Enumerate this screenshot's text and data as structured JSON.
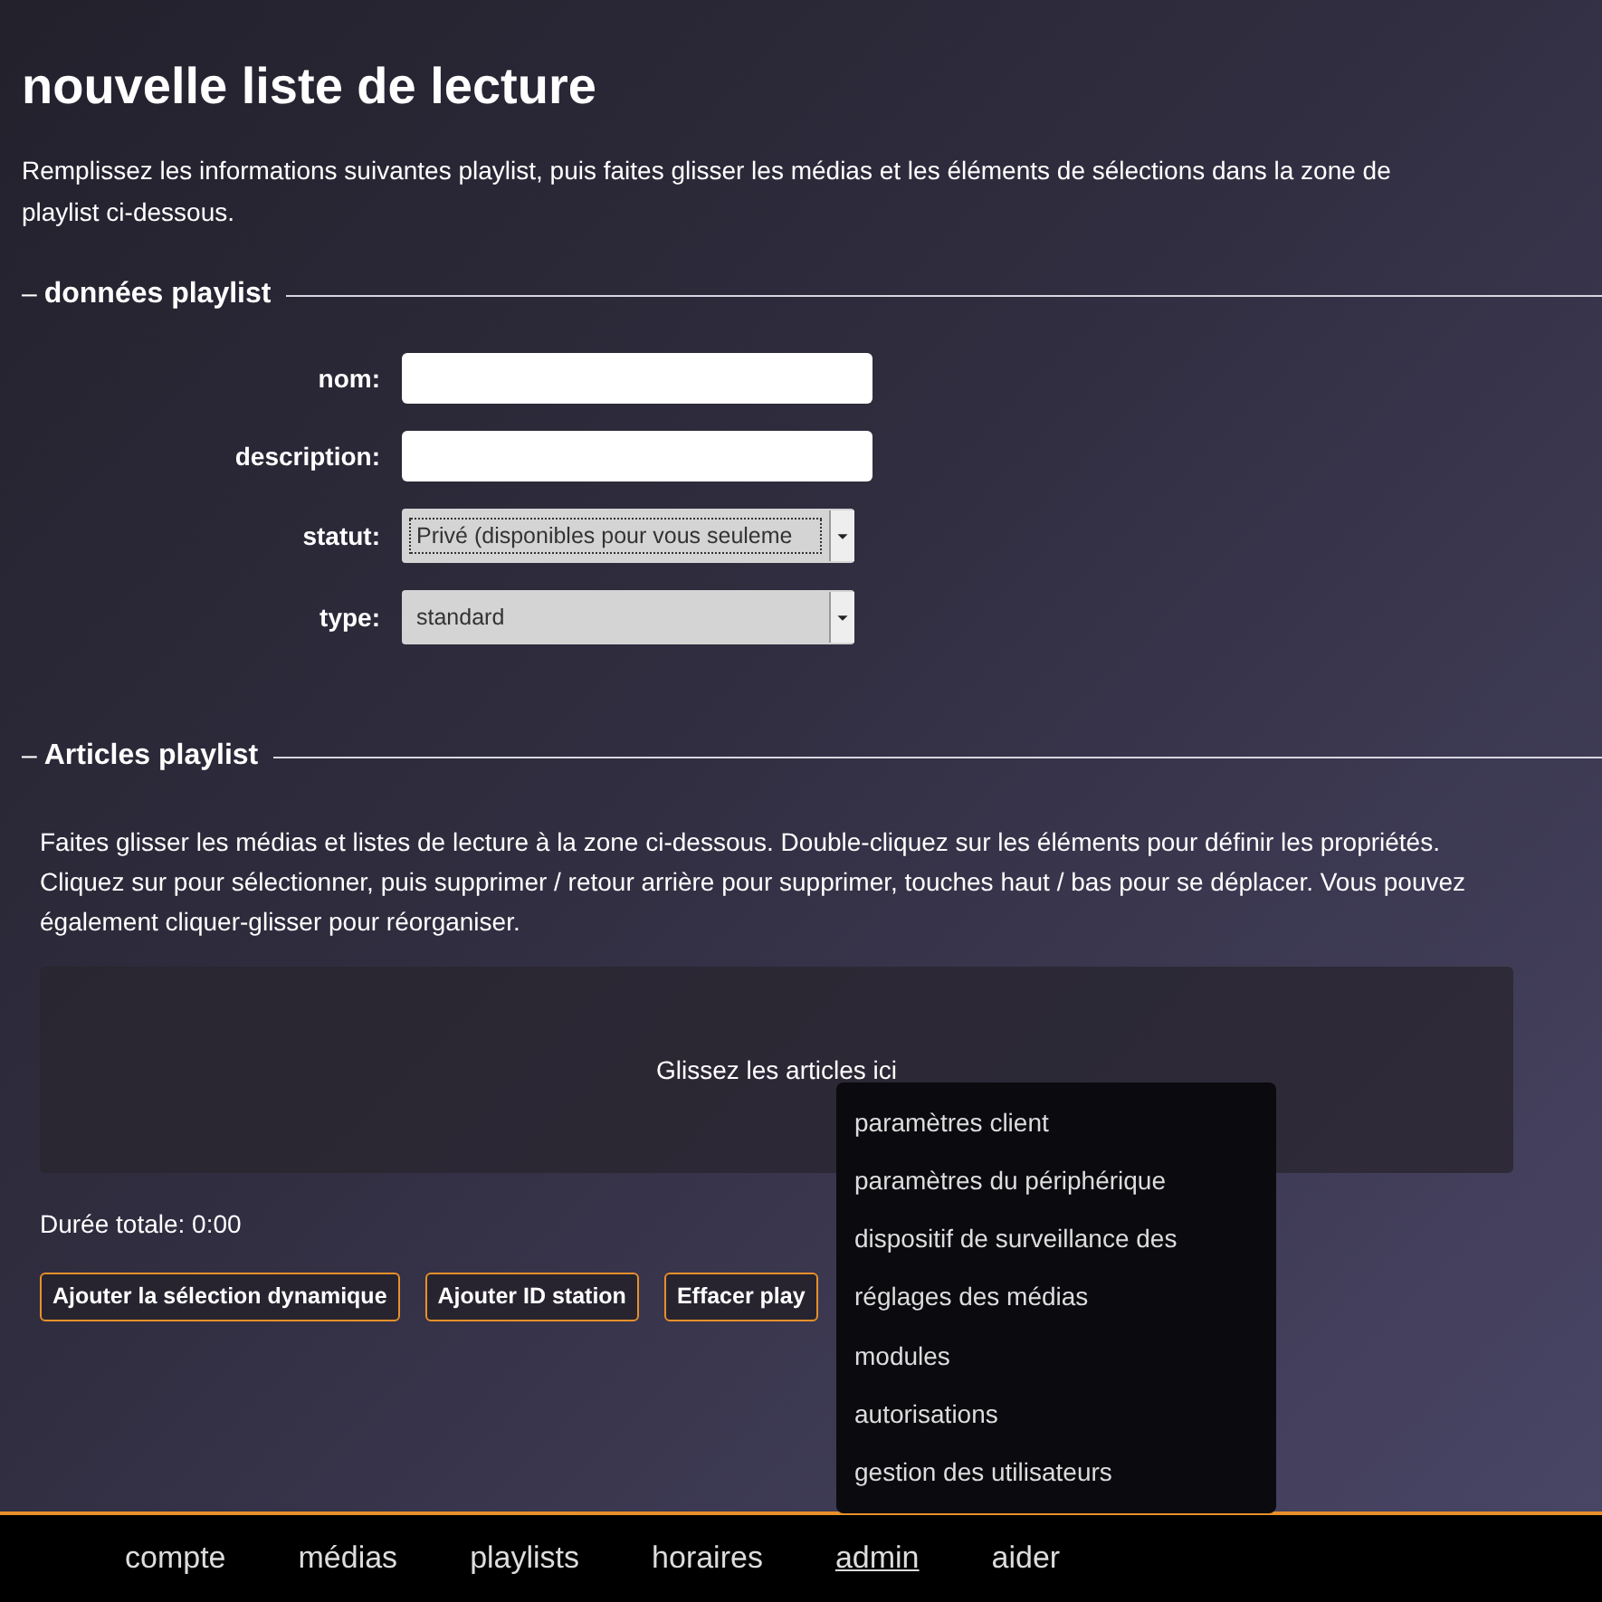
{
  "page": {
    "title": "nouvelle liste de lecture",
    "intro": "Remplissez les informations suivantes playlist, puis faites glisser les médias et les éléments de sélections dans la zone de playlist ci-dessous."
  },
  "playlist_data": {
    "legend_toggle": "–",
    "legend": "données playlist",
    "fields": [
      {
        "kind": "text",
        "label": "nom:"
      },
      {
        "kind": "text",
        "label": "description:"
      },
      {
        "kind": "select",
        "label": "statut:",
        "value": "Privé (disponibles pour vous seuleme",
        "focused": true
      },
      {
        "kind": "select",
        "label": "type:",
        "value": "standard",
        "focused": false
      }
    ]
  },
  "articles": {
    "legend_toggle": "–",
    "legend": "Articles playlist",
    "help": "Faites glisser les médias et listes de lecture à la zone ci-dessous. Double-cliquez sur les éléments pour définir les propriétés. Cliquez sur pour sélectionner, puis supprimer / retour arrière pour supprimer, touches haut / bas pour se déplacer. Vous pouvez également cliquer-glisser pour réorganiser.",
    "drop_zone": "Glissez les articles ici",
    "total": "Durée totale: 0:00",
    "buttons": [
      "Ajouter la sélection dynamique",
      "Ajouter ID station",
      "Effacer play"
    ]
  },
  "admin_menu": [
    "paramètres client",
    "paramètres du périphérique",
    "dispositif de surveillance des",
    "réglages des médias",
    "modules",
    "autorisations",
    "gestion des utilisateurs"
  ],
  "nav": [
    {
      "label": "compte",
      "selected": false
    },
    {
      "label": "médias",
      "selected": false
    },
    {
      "label": "playlists",
      "selected": false
    },
    {
      "label": "horaires",
      "selected": false
    },
    {
      "label": "admin",
      "selected": true
    },
    {
      "label": "aider",
      "selected": false
    }
  ]
}
